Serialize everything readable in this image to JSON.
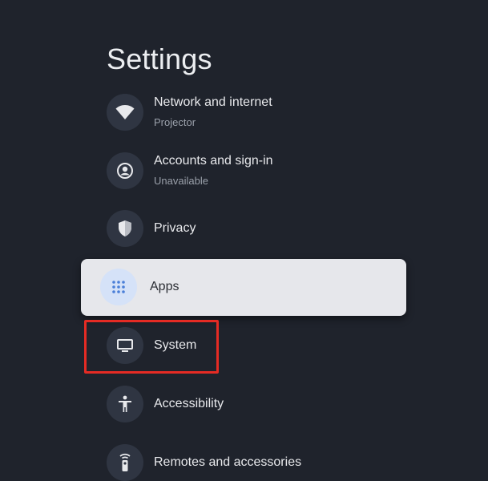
{
  "page": {
    "title": "Settings"
  },
  "items": [
    {
      "label": "Network and internet",
      "sublabel": "Projector",
      "icon": "wifi-icon"
    },
    {
      "label": "Accounts and sign-in",
      "sublabel": "Unavailable",
      "icon": "account-icon"
    },
    {
      "label": "Privacy",
      "icon": "shield-icon"
    },
    {
      "label": "Apps",
      "icon": "apps-grid-icon",
      "focused": true
    },
    {
      "label": "System",
      "icon": "tv-icon",
      "annotated": true
    },
    {
      "label": "Accessibility",
      "icon": "accessibility-icon"
    },
    {
      "label": "Remotes and accessories",
      "icon": "remote-icon"
    }
  ],
  "colors": {
    "background": "#1f232c",
    "focused_card": "#e6e7eb",
    "accent_blue": "#4a7fd8",
    "annotation_red": "#e52b24"
  }
}
